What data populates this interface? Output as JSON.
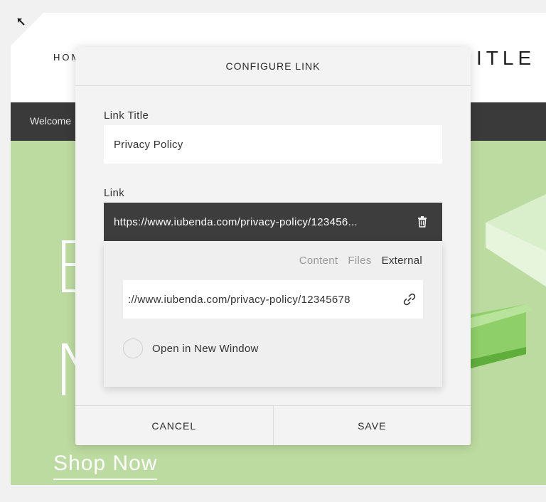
{
  "site": {
    "nav_home": "HOM",
    "site_title": "ITLE",
    "banner_text": "Welcome",
    "hero_letter_1": "E",
    "hero_letter_2": "N",
    "shop_now": "Shop Now"
  },
  "modal": {
    "title": "CONFIGURE LINK",
    "link_title_label": "Link Title",
    "link_title_value": "Privacy Policy",
    "link_label": "Link",
    "link_value": "https://www.iubenda.com/privacy-policy/123456...",
    "tabs": [
      {
        "label": "Content",
        "active": false
      },
      {
        "label": "Files",
        "active": false
      },
      {
        "label": "External",
        "active": true
      }
    ],
    "external_url_value": "://www.iubenda.com/privacy-policy/12345678",
    "open_new_window_label": "Open in New Window",
    "open_new_window_checked": false,
    "cancel_label": "CANCEL",
    "save_label": "SAVE"
  },
  "icons": {
    "collapse": "collapse-arrow-icon",
    "trash": "trash-icon",
    "link": "chain-link-icon"
  },
  "colors": {
    "hero_green": "#bcdba0",
    "banner_dark": "#3a3a3a",
    "link_bar": "#3d3d3d",
    "modal_bg": "#f3f3f3"
  }
}
